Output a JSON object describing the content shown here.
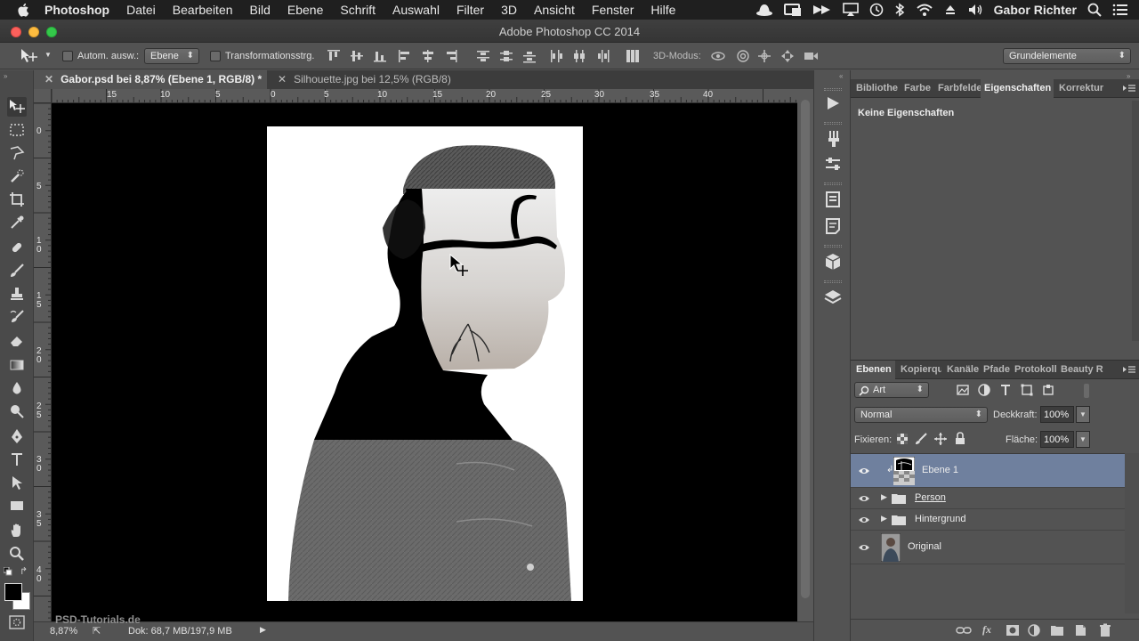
{
  "menubar": {
    "items": [
      "Photoshop",
      "Datei",
      "Bearbeiten",
      "Bild",
      "Ebene",
      "Schrift",
      "Auswahl",
      "Filter",
      "3D",
      "Ansicht",
      "Fenster",
      "Hilfe"
    ],
    "user": "Gabor Richter"
  },
  "window": {
    "title": "Adobe Photoshop CC 2014"
  },
  "options": {
    "auto_select_label": "Autom. ausw.:",
    "auto_select_value": "Ebene",
    "transform_label": "Transformationsstrg.",
    "mode_3d_label": "3D-Modus:",
    "workspace_value": "Grundelemente"
  },
  "tabs": [
    {
      "label": "Gabor.psd bei 8,87% (Ebene 1, RGB/8) *",
      "active": true
    },
    {
      "label": "Silhouette.jpg bei 12,5% (RGB/8)",
      "active": false
    }
  ],
  "ruler": {
    "top": [
      "15",
      "10",
      "5",
      "0",
      "5",
      "10",
      "15",
      "20",
      "25",
      "30",
      "35",
      "40"
    ],
    "left": [
      "0",
      "5",
      "1\n0",
      "1\n5",
      "2\n0",
      "2\n5",
      "3\n0",
      "3\n5",
      "4\n0"
    ]
  },
  "status": {
    "zoom": "8,87%",
    "doc": "Dok: 68,7 MB/197,9 MB",
    "watermark": "PSD-Tutorials.de"
  },
  "properties_panel": {
    "tabs": [
      "Bibliothe",
      "Farbe",
      "Farbfelde",
      "Eigenschaften",
      "Korrektur"
    ],
    "active_tab": "Eigenschaften",
    "empty_text": "Keine Eigenschaften"
  },
  "layers_panel": {
    "tabs": [
      "Ebenen",
      "Kopierqu",
      "Kanäle",
      "Pfade",
      "Protokoll",
      "Beauty R"
    ],
    "active_tab": "Ebenen",
    "filter_value": "Art",
    "blend_mode": "Normal",
    "opacity_label": "Deckkraft:",
    "opacity_value": "100%",
    "lock_label": "Fixieren:",
    "fill_label": "Fläche:",
    "fill_value": "100%",
    "layers": [
      {
        "name": "Ebene 1",
        "selected": true,
        "type": "layer"
      },
      {
        "name": "Person",
        "selected": false,
        "type": "group"
      },
      {
        "name": "Hintergrund",
        "selected": false,
        "type": "group"
      },
      {
        "name": "Original",
        "selected": false,
        "type": "layer"
      }
    ]
  },
  "colors": {
    "menubar_bg": "#1f1f1f",
    "panel_bg": "#535353",
    "selected_layer": "#6f809e",
    "canvas_bg": "#000000"
  }
}
